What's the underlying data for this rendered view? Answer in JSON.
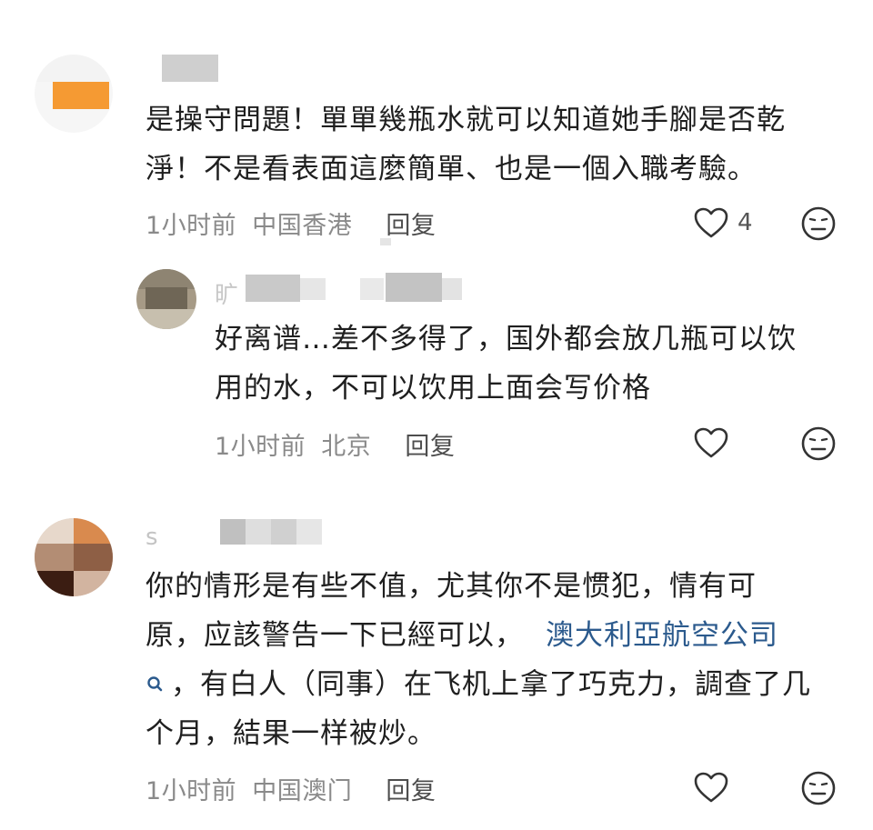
{
  "comments": [
    {
      "text": "是操守問題！單單幾瓶水就可以知道她手腳是否乾淨！不是看表面這麼簡單、也是一個入職考驗。",
      "line1": "是操守問題！單單幾瓶水就可以知道她手腳是否乾",
      "line2": "淨！不是看表面這麼簡單、也是一個入職考驗。",
      "time": "1小时前",
      "location": "中国香港",
      "reply_label": "回复",
      "like_count": "4",
      "like_icon": "heart-outline-icon",
      "dislike_icon": "neutral-face-icon",
      "reply": {
        "name_initial": "旷",
        "line1": "好离谱…差不多得了，国外都会放几瓶可以饮",
        "line2": "用的水，不可以饮用上面会写价格",
        "time": "1小时前",
        "location": "北京",
        "reply_label": "回复"
      }
    },
    {
      "name_initial": "s",
      "line1": "你的情形是有些不值，尤其你不是惯犯，情有可",
      "line2_prefix": "原，应該警告一下已經可以，",
      "link_text": "澳大利亞航空公司",
      "line3": "，有白人（同事）在飞机上拿了巧克力，調查了几",
      "line4": "个月，結果一样被炒。",
      "search_icon": "search-icon",
      "time": "1小时前",
      "location": "中国澳门",
      "reply_label": "回复"
    }
  ],
  "colors": {
    "text": "#1f1f1f",
    "meta": "#8a8a8a",
    "link": "#2b5a8d",
    "avatar1_orange": "#f59a33"
  }
}
